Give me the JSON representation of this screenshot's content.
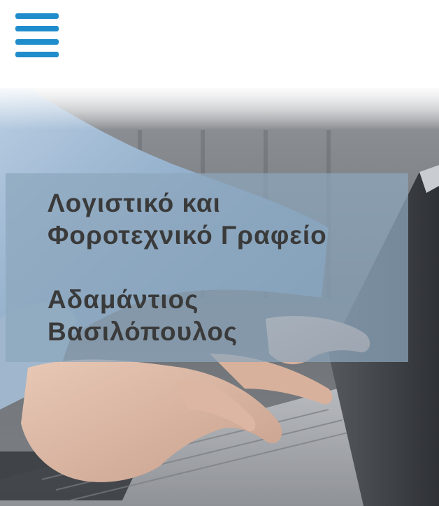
{
  "header": {
    "menu_icon": "hamburger-menu-icon",
    "accent_color": "#1f8ccc"
  },
  "hero": {
    "background": "photo-hands-typing-on-laptop",
    "title_line1": "Λογιστικό και",
    "title_line2": "Φοροτεχνικό Γραφείο",
    "name_line1": "Αδαμάντιος",
    "name_line2": "Βασιλόπουλος"
  }
}
